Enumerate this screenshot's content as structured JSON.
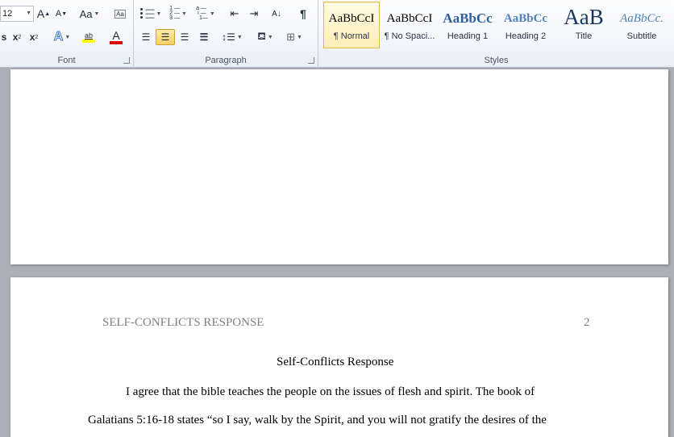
{
  "ribbon": {
    "font_group": {
      "label": "Font",
      "font_size": "12",
      "grow_font_label": "A",
      "shrink_font_label": "A",
      "change_case_label": "Aa",
      "clear_format_label": "Aa",
      "bold_like_label": "s",
      "subscript_label": "x",
      "superscript_label": "x",
      "text_effects_label": "A",
      "highlight_label": "ab",
      "font_color_label": "A"
    },
    "paragraph_group": {
      "label": "Paragraph",
      "pilcrow": "¶",
      "sort_label": "A↓"
    },
    "styles_group": {
      "label": "Styles",
      "tiles": [
        {
          "preview": "AaBbCcI",
          "name": "¶ Normal"
        },
        {
          "preview": "AaBbCcI",
          "name": "¶ No Spaci..."
        },
        {
          "preview": "AaBbCc",
          "name": "Heading 1"
        },
        {
          "preview": "AaBbCc",
          "name": "Heading 2"
        },
        {
          "preview": "AaB",
          "name": "Title"
        },
        {
          "preview": "AaBbCc.",
          "name": "Subtitle"
        }
      ]
    },
    "colors": {
      "highlight": "#ffff00",
      "font_color": "#e00000",
      "heading": "#2e5e9e",
      "title": "#17365d",
      "subtitle": "#4f81bd"
    }
  },
  "document": {
    "running_head": "SELF-CONFLICTS RESPONSE",
    "page_number": "2",
    "title": "Self-Conflicts Response",
    "line1": "I agree that the bible teaches the people on the issues  of flesh and spirit. The book of",
    "line2": "Galatians 5:16-18 states “so I say, walk by the Spirit, and you will not gratify the desires of the"
  }
}
